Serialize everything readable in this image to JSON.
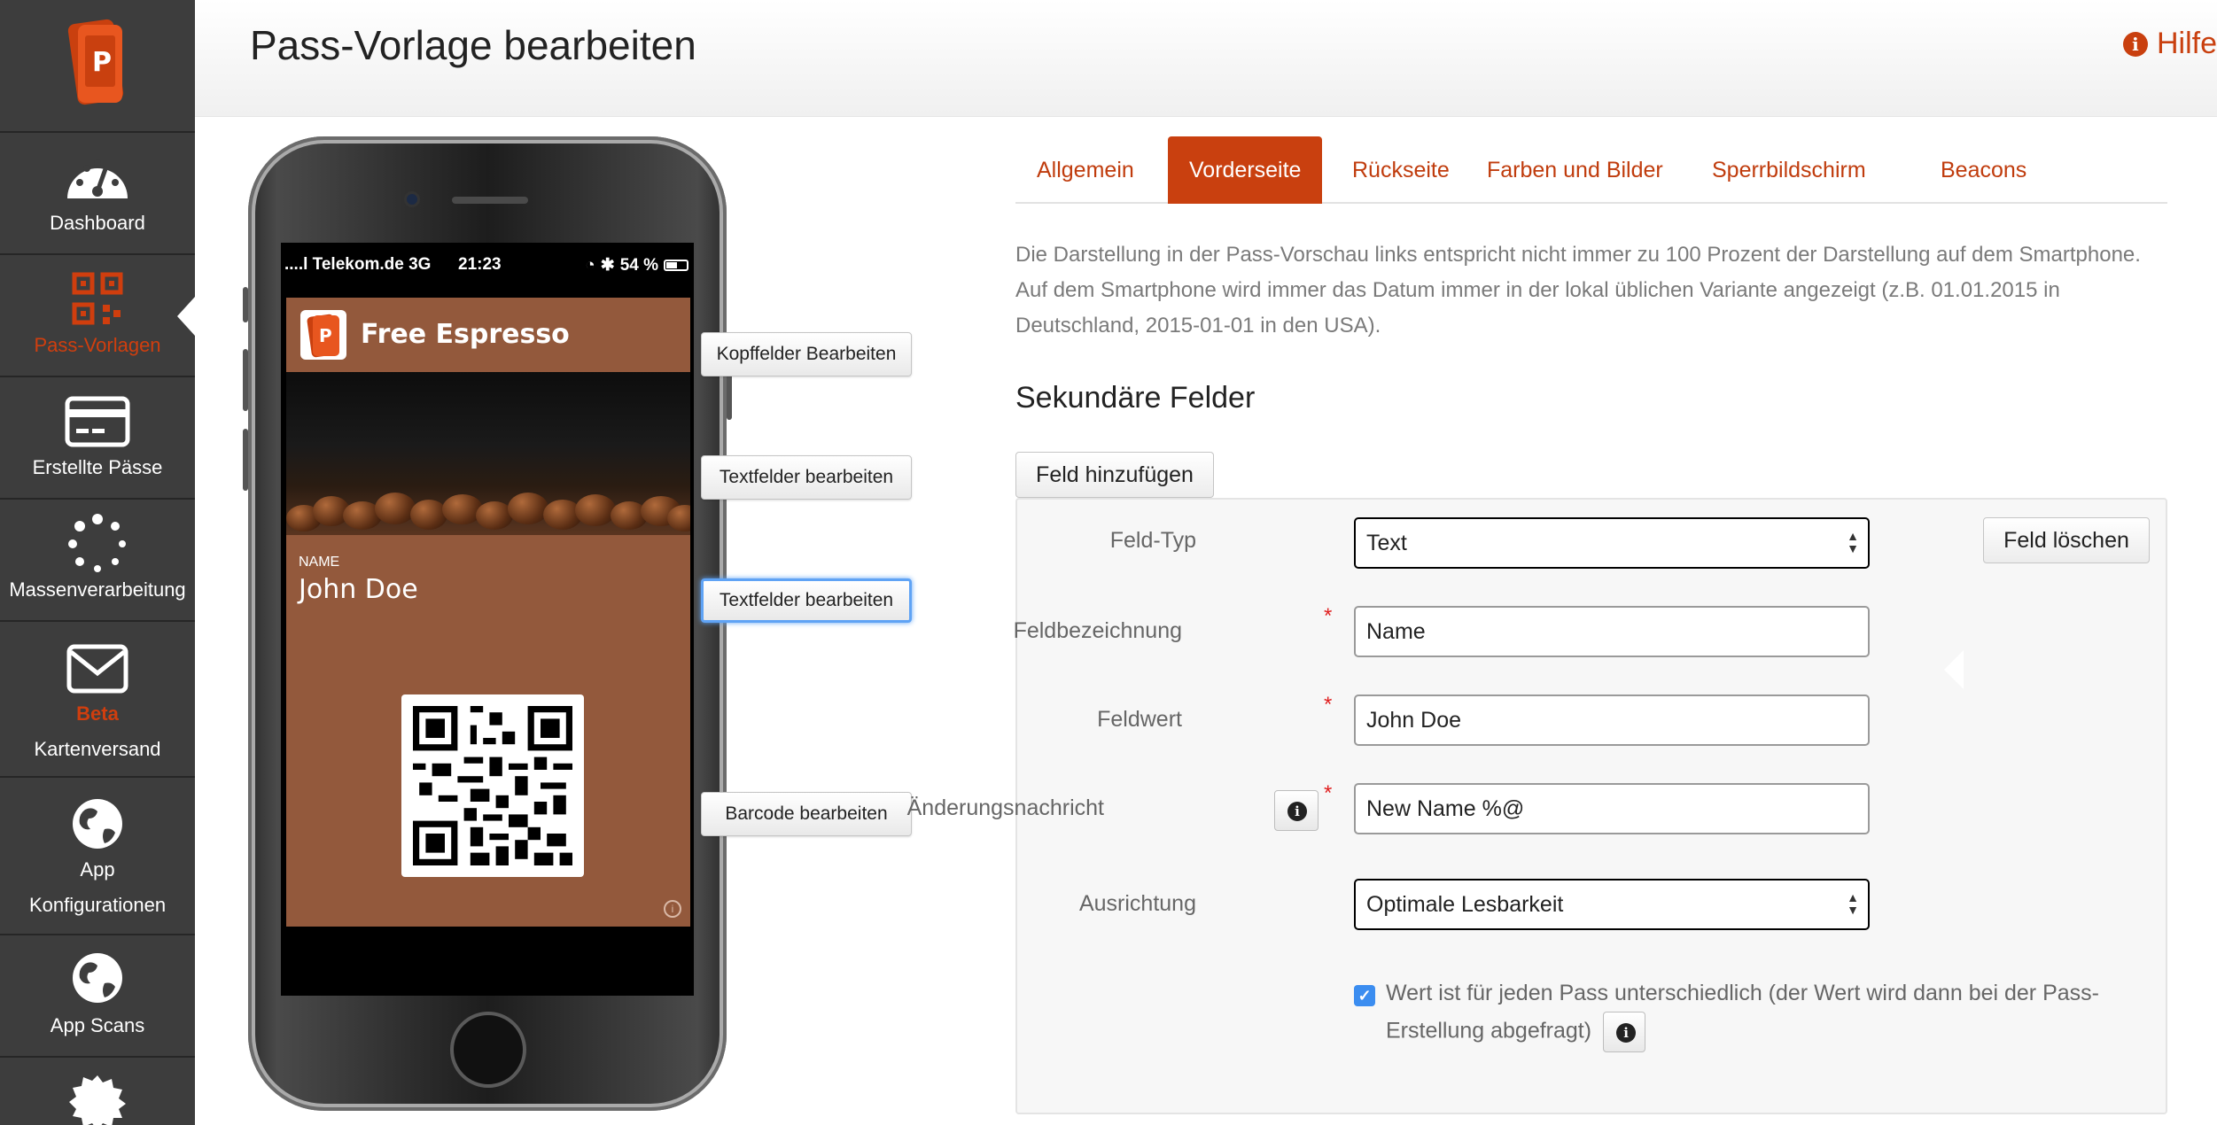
{
  "header": {
    "title": "Pass-Vorlage bearbeiten",
    "help": "Hilfe"
  },
  "sidebar": {
    "items": [
      {
        "label": "Dashboard",
        "icon": "dashboard-gauge-icon"
      },
      {
        "label": "Pass-Vorlagen",
        "icon": "qr-code-icon",
        "active": true
      },
      {
        "label": "Erstellte Pässe",
        "icon": "card-icon"
      },
      {
        "label": "Massenverarbeitung",
        "icon": "spinner-icon"
      },
      {
        "badge": "Beta",
        "label": "Kartenversand",
        "icon": "envelope-icon"
      },
      {
        "label1": "App",
        "label2": "Konfigurationen",
        "icon": "globe-icon"
      },
      {
        "label": "App Scans",
        "icon": "globe-icon"
      }
    ]
  },
  "phone": {
    "carrier": "....l Telekom.de  3G",
    "time": "21:23",
    "battery": "54 %",
    "pass_title": "Free Espresso",
    "field_label": "NAME",
    "field_value": "John Doe",
    "pass_color": "#93593c"
  },
  "edit_buttons": {
    "header": "Kopffelder Bearbeiten",
    "primary": "Textfelder bearbeiten",
    "secondary": "Textfelder bearbeiten",
    "barcode": "Barcode bearbeiten"
  },
  "tabs": [
    {
      "label": "Allgemein"
    },
    {
      "label": "Vorderseite",
      "active": true
    },
    {
      "label": "Rückseite"
    },
    {
      "label": "Farben und Bilder"
    },
    {
      "label": "Sperrbildschirm"
    },
    {
      "label": "Beacons"
    }
  ],
  "info_text": "Die Darstellung in der Pass-Vorschau links entspricht nicht immer zu 100 Prozent der Darstellung auf dem Smartphone. Auf dem Smartphone wird immer das Datum immer in der lokal üblichen Variante angezeigt (z.B. 01.01.2015 in Deutschland, 2015-01-01 in den USA).",
  "section": {
    "title": "Sekundäre Felder",
    "add_button": "Feld hinzufügen",
    "delete_button": "Feld löschen"
  },
  "form": {
    "field_type": {
      "label": "Feld-Typ",
      "value": "Text"
    },
    "field_name": {
      "label": "Feldbezeichnung",
      "value": "Name"
    },
    "field_value": {
      "label": "Feldwert",
      "value": "John Doe"
    },
    "change_message": {
      "label": "Änderungsnachricht",
      "value": "New Name %@"
    },
    "alignment": {
      "label": "Ausrichtung",
      "value": "Optimale Lesbarkeit"
    },
    "checkbox_text": "Wert ist für jeden Pass unterschiedlich (der Wert wird dann bei der Pass-Erstellung abgefragt)",
    "required_mark": "*"
  },
  "colors": {
    "accent": "#c9400f",
    "sidebar": "#3d3d3d",
    "checkbox": "#3b8df0"
  }
}
